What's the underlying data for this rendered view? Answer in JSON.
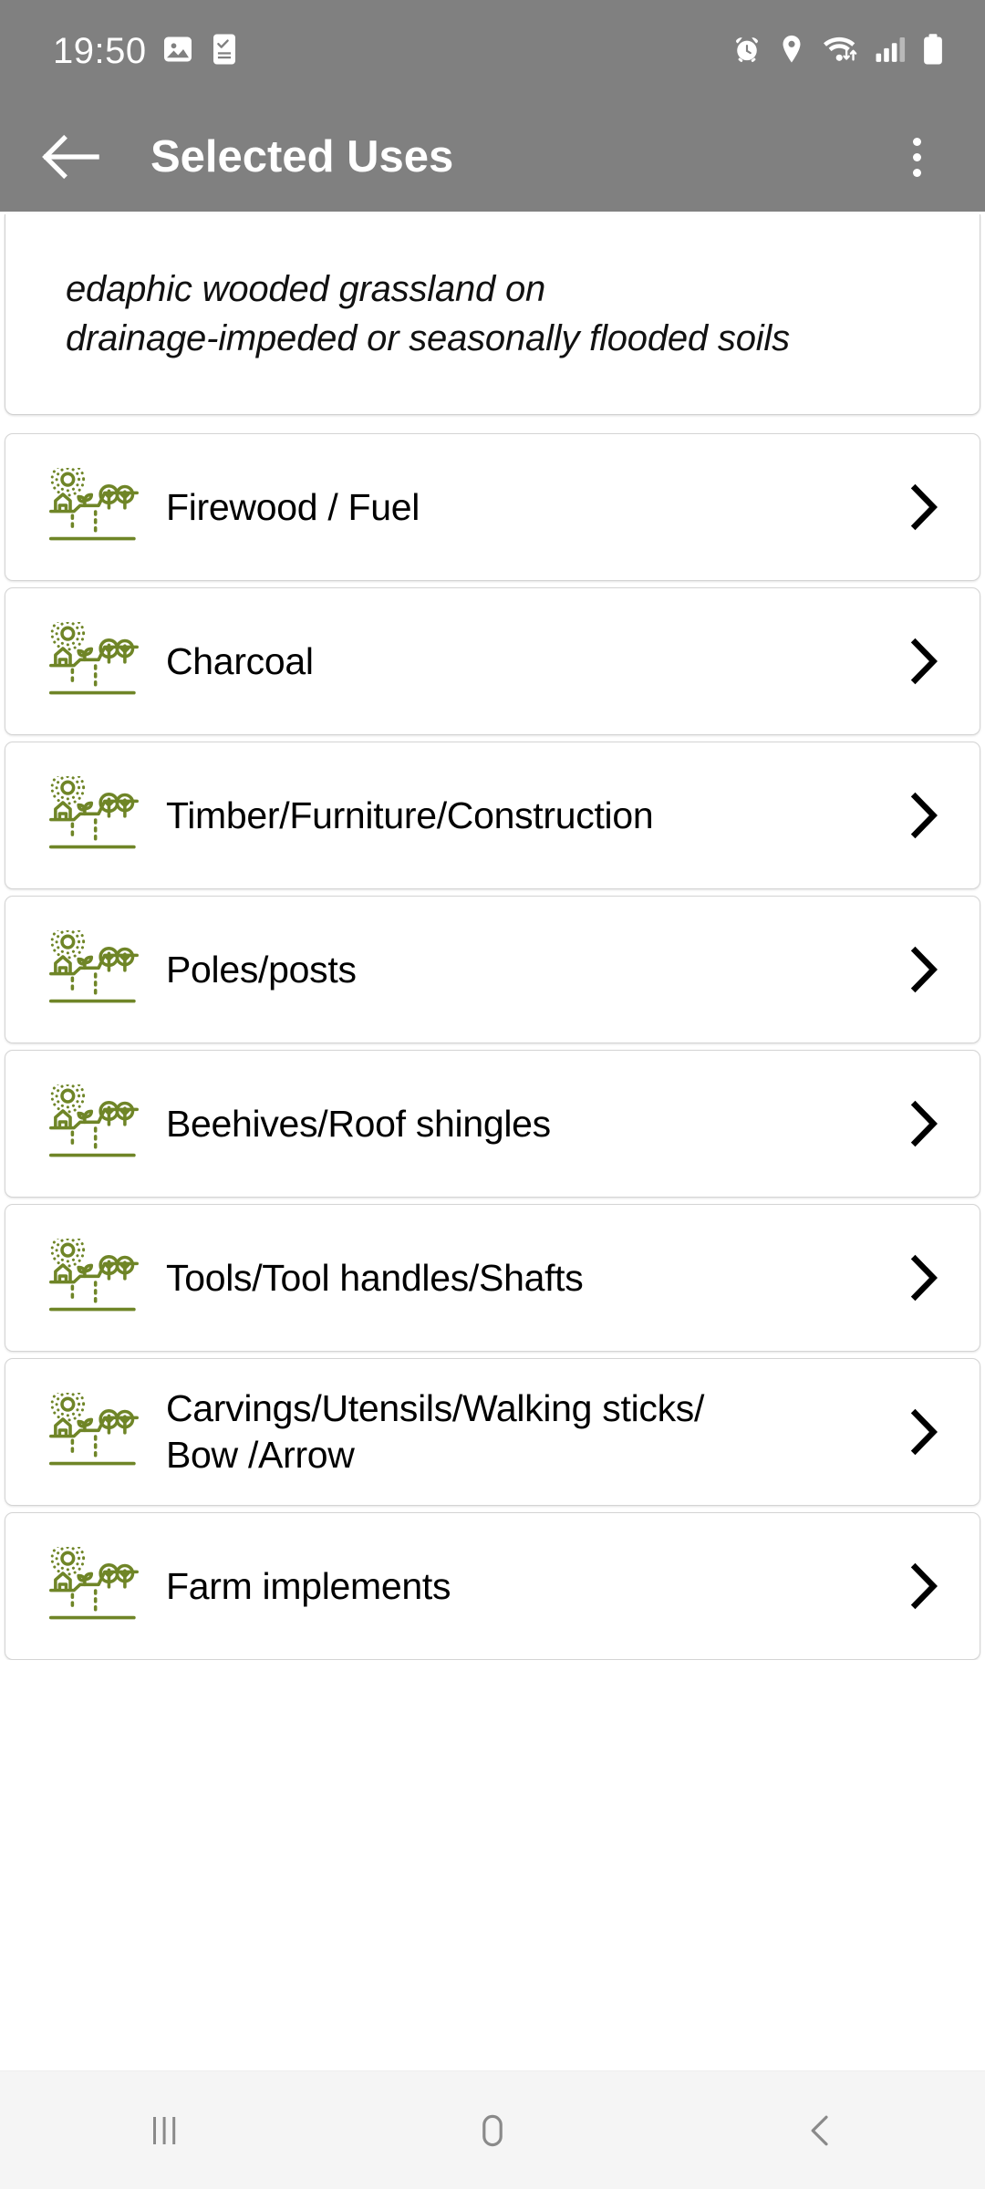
{
  "status_bar": {
    "time": "19:50",
    "left_icons": [
      "photo-icon",
      "phone-check-icon"
    ],
    "right_icons": [
      "alarm-icon",
      "location-icon",
      "wifi-icon",
      "signal-icon",
      "battery-icon"
    ],
    "background_color": "#808080",
    "foreground_color": "#ffffff"
  },
  "app_bar": {
    "back_label": "back-arrow",
    "title": "Selected Uses",
    "overflow_label": "more-options",
    "background_color": "#808080"
  },
  "description": {
    "text": "edaphic wooded grassland on\ndrainage-impeded or seasonally flooded soils"
  },
  "theme": {
    "icon_color": "#6f8527",
    "text_color": "#000000",
    "card_background": "#ffffff",
    "card_border": "#d4d4d4",
    "page_background": "#ffffff",
    "nav_background": "#f5f5f5",
    "nav_icon_color": "#8a8a8a"
  },
  "list": {
    "item_icon_name": "agroforestry-landscape-icon",
    "chevron_name": "chevron-right-icon",
    "items": [
      {
        "label": "Firewood / Fuel"
      },
      {
        "label": "Charcoal"
      },
      {
        "label": "Timber/Furniture/Construction"
      },
      {
        "label": "Poles/posts"
      },
      {
        "label": "Beehives/Roof shingles"
      },
      {
        "label": "Tools/Tool handles/Shafts"
      },
      {
        "label": "Carvings/Utensils/Walking sticks/\nBow /Arrow"
      },
      {
        "label": "Farm implements"
      }
    ]
  },
  "nav_bar": {
    "recents_label": "recents",
    "home_label": "home",
    "back_label": "back"
  }
}
